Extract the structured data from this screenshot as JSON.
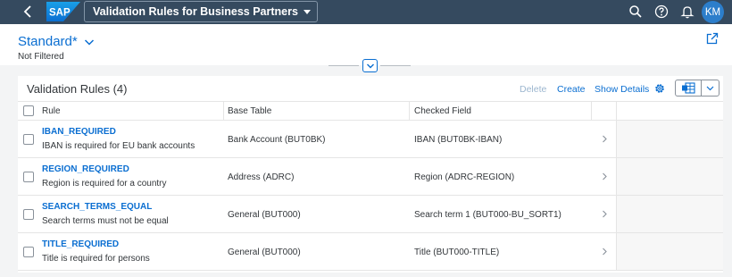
{
  "shell": {
    "app_title": "Validation Rules for Business Partners",
    "avatar_initials": "KM",
    "logo_text": "SAP"
  },
  "header": {
    "variant_name": "Standard*",
    "filter_info": "Not Filtered"
  },
  "table": {
    "title": "Validation Rules (4)",
    "toolbar": {
      "delete_label": "Delete",
      "create_label": "Create",
      "show_details_label": "Show Details"
    },
    "columns": {
      "rule": "Rule",
      "base_table": "Base Table",
      "checked_field": "Checked Field"
    },
    "rows": [
      {
        "name": "IBAN_REQUIRED",
        "description": "IBAN is required for EU bank accounts",
        "base_table": "Bank Account (BUT0BK)",
        "checked_field": "IBAN (BUT0BK-IBAN)"
      },
      {
        "name": "REGION_REQUIRED",
        "description": "Region is required for a country",
        "base_table": "Address (ADRC)",
        "checked_field": "Region (ADRC-REGION)"
      },
      {
        "name": "SEARCH_TERMS_EQUAL",
        "description": "Search terms must not be equal",
        "base_table": "General (BUT000)",
        "checked_field": "Search term 1 (BUT000-BU_SORT1)"
      },
      {
        "name": "TITLE_REQUIRED",
        "description": "Title is required for persons",
        "base_table": "General (BUT000)",
        "checked_field": "Title (BUT000-TITLE)"
      }
    ]
  },
  "colors": {
    "shell_bg": "#354a5f",
    "link": "#0a6ed1",
    "avatar_bg": "#2c7ecb",
    "page_bg": "#f3f4f5",
    "disabled_text": "#9cb6cf"
  },
  "icons": [
    "back-icon",
    "chevron-down-icon",
    "search-icon",
    "help-icon",
    "bell-icon",
    "share-icon",
    "collapse-icon",
    "gear-icon",
    "export-icon",
    "nav-arrow-icon"
  ]
}
